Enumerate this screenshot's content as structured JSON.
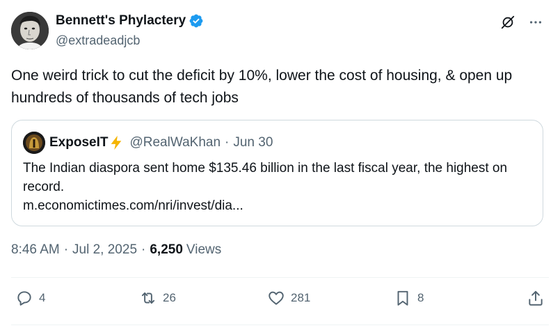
{
  "author": {
    "display_name": "Bennett's Phylactery",
    "handle": "@extradeadjcb",
    "verified": true,
    "verified_color": "#1d9bf0"
  },
  "header_icons": [
    "grok-icon",
    "more-icon"
  ],
  "tweet": {
    "text": "One weird trick to cut the deficit by 10%, lower the cost of housing, & open up hundreds of thousands of tech jobs"
  },
  "quoted": {
    "display_name": "ExposeIT",
    "emoji": "⚡",
    "handle": "@RealWaKhan",
    "dot": "·",
    "date": "Jun 30",
    "text": "The Indian diaspora sent home $135.46 billion in the last fiscal year, the highest on record.",
    "link": "m.economictimes.com/nri/invest/dia..."
  },
  "meta": {
    "time": "8:46 AM",
    "sep1": "·",
    "date": "Jul 2, 2025",
    "sep2": "·",
    "views_count": "6,250",
    "views_label": "Views"
  },
  "actions": {
    "replies": "4",
    "reposts": "26",
    "likes": "281",
    "bookmarks": "8"
  },
  "colors": {
    "text": "#0f1419",
    "secondary": "#536471",
    "border": "#cfd9de",
    "bolt": "#f5b400"
  }
}
